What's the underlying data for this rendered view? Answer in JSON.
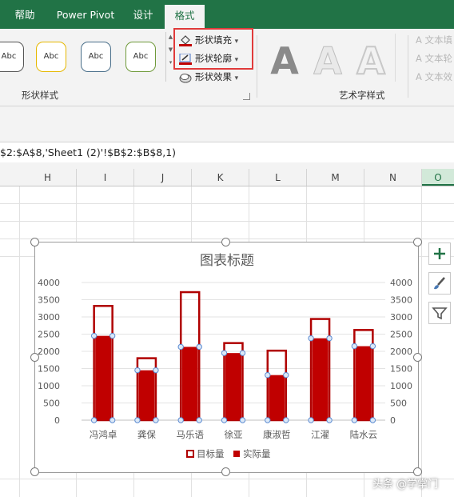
{
  "ribbon": {
    "tabs": [
      {
        "label": "帮助"
      },
      {
        "label": "Power Pivot"
      },
      {
        "label": "设计"
      },
      {
        "label": "格式"
      }
    ],
    "shape_style_samples": [
      "Abc",
      "Abc",
      "Abc",
      "Abc"
    ],
    "shape_styles_group_label": "形状样式",
    "commands": {
      "shape_fill": "形状填充",
      "shape_outline": "形状轮廓",
      "shape_effects": "形状效果"
    },
    "wordart_letter": "A",
    "wordart_group_label": "艺术字样式",
    "wordart_side": [
      "文本填",
      "文本轮",
      "文本效"
    ]
  },
  "formula_bar": {
    "text": "$2:$A$8,'Sheet1 (2)'!$B$2:$B$8,1)"
  },
  "columns": [
    "H",
    "I",
    "J",
    "K",
    "L",
    "M",
    "N",
    "O"
  ],
  "selected_column": "O",
  "chart_data": {
    "type": "bar",
    "title": "图表标题",
    "categories": [
      "冯鸿卓",
      "龚保",
      "马乐语",
      "徐亚",
      "康淑哲",
      "江濯",
      "陆水云"
    ],
    "series": [
      {
        "name": "目标量",
        "values": [
          3320,
          1800,
          3720,
          2240,
          2020,
          2940,
          2620
        ]
      },
      {
        "name": "实际量",
        "values": [
          2450,
          1450,
          2130,
          1950,
          1310,
          2380,
          2150
        ]
      }
    ],
    "y_ticks": [
      "4000",
      "3500",
      "3000",
      "2500",
      "2000",
      "1500",
      "1000",
      "500",
      "0"
    ],
    "ylim": [
      0,
      4000
    ],
    "colors": {
      "target_outline": "#b00000",
      "actual_fill": "#c00000"
    },
    "legend_position": "bottom"
  },
  "chart_tools": [
    "plus-icon",
    "brush-icon",
    "filter-icon"
  ],
  "watermark": "头条 @学掌门"
}
